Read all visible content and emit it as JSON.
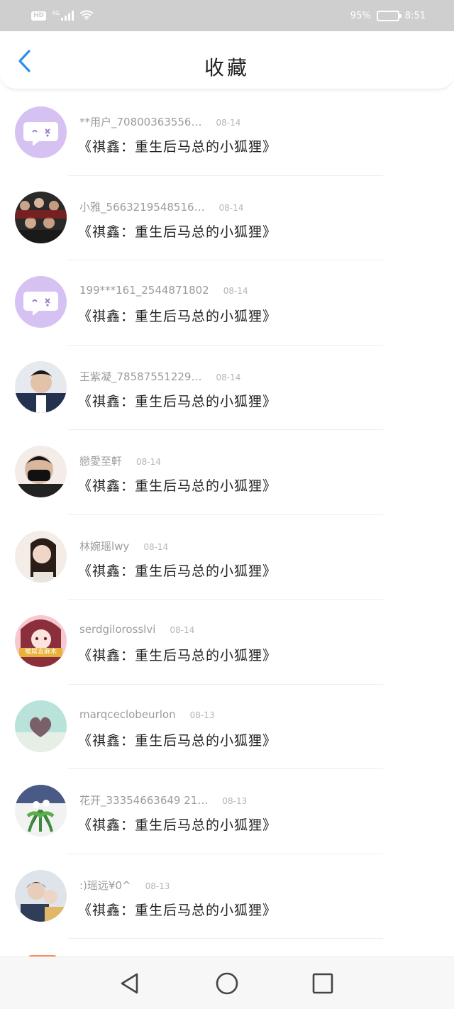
{
  "status_bar": {
    "hd_label": "HD",
    "network_label": "4G",
    "battery_percent": "95%",
    "battery_level": 0.95,
    "time": "8:51"
  },
  "header": {
    "title": "收藏",
    "back_icon": "chevron-left-icon",
    "accent_color": "#2b8fe6"
  },
  "favorites": [
    {
      "user": "**用户_70800363556…",
      "date": "08-14",
      "title": "《祺鑫：重生后马总的小狐狸》",
      "avatar": "default-chat-avatar"
    },
    {
      "user": "小雅_5663219548516…",
      "date": "08-14",
      "title": "《祺鑫：重生后马总的小狐狸》",
      "avatar": "group-photo-avatar"
    },
    {
      "user": "199***161_2544871802",
      "date": "08-14",
      "title": "《祺鑫：重生后马总的小狐狸》",
      "avatar": "default-chat-avatar"
    },
    {
      "user": "王紫凝_78587551229…",
      "date": "08-14",
      "title": "《祺鑫：重生后马总的小狐狸》",
      "avatar": "portrait-avatar"
    },
    {
      "user": "戀愛至軒",
      "date": "08-14",
      "title": "《祺鑫：重生后马总的小狐狸》",
      "avatar": "masked-portrait-avatar"
    },
    {
      "user": "林婉瑶lwy",
      "date": "08-14",
      "title": "《祺鑫：重生后马总的小狐狸》",
      "avatar": "girl-portrait-avatar"
    },
    {
      "user": "serdgilorosslvi",
      "date": "08-14",
      "title": "《祺鑫：重生后马总的小狐狸》",
      "avatar": "anime-girl-avatar",
      "avatar_caption": "嘘屌言麻木"
    },
    {
      "user": "marqceclobeurlon",
      "date": "08-13",
      "title": "《祺鑫：重生后马总的小狐狸》",
      "avatar": "heart-hands-avatar"
    },
    {
      "user": "花开_33354663649 21…",
      "date": "08-13",
      "title": "《祺鑫：重生后马总的小狐狸》",
      "avatar": "flower-avatar"
    },
    {
      "user": ":)瑶远¥0^",
      "date": "08-13",
      "title": "《祺鑫：重生后马总的小狐狸》",
      "avatar": "couple-avatar"
    }
  ],
  "nav_bar": {
    "back_icon": "triangle-back-icon",
    "home_icon": "circle-home-icon",
    "recent_icon": "square-recent-icon"
  }
}
